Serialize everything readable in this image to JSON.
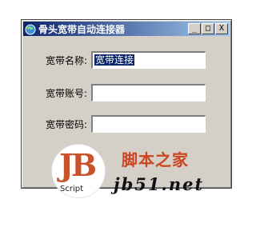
{
  "window": {
    "title": "骨头宽带自动连接器",
    "controls": [
      "_",
      "□",
      "X"
    ]
  },
  "form": {
    "rows": [
      {
        "label": "宽带名称:",
        "value": "宽带连接"
      },
      {
        "label": "宽带账号:",
        "value": ""
      },
      {
        "label": "宽带密码:",
        "value": ""
      }
    ]
  },
  "watermark": {
    "logo": "JB",
    "logo_sub": "Script",
    "site_name": "脚本之家",
    "url": "jb51.net"
  }
}
